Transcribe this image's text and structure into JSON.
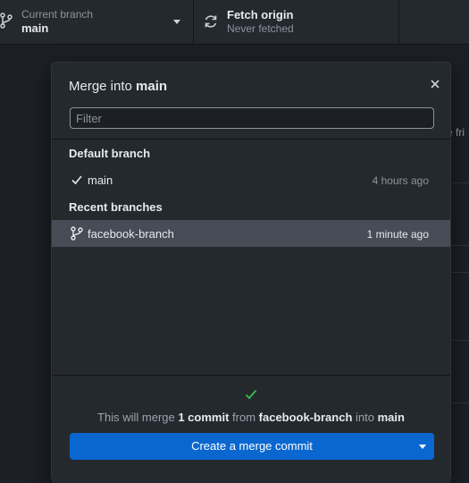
{
  "toolbar": {
    "branch": {
      "subtitle": "Current branch",
      "title": "main"
    },
    "fetch": {
      "title": "Fetch origin",
      "subtitle": "Never fetched"
    }
  },
  "background": {
    "text_fragment": "e fri"
  },
  "dialog": {
    "title_prefix": "Merge into ",
    "title_branch": "main",
    "filter_placeholder": "Filter",
    "default_section": "Default branch",
    "default_branch": {
      "name": "main",
      "time": "4 hours ago"
    },
    "recent_section": "Recent branches",
    "recent_branches": [
      {
        "name": "facebook-branch",
        "time": "1 minute ago",
        "selected": true
      }
    ],
    "summary": {
      "t1": "This will merge ",
      "count": "1 commit",
      "t2": " from ",
      "from": "facebook-branch",
      "t3": " into ",
      "into": "main"
    },
    "merge_button": "Create a merge commit"
  },
  "colors": {
    "accent": "#0b67d0",
    "success": "#3fb950",
    "selected_row": "#464d56"
  },
  "icons": [
    "branch-icon",
    "sync-icon",
    "close-icon",
    "check-icon",
    "git-branch-icon",
    "checkmark-icon",
    "caret-down-icon"
  ]
}
